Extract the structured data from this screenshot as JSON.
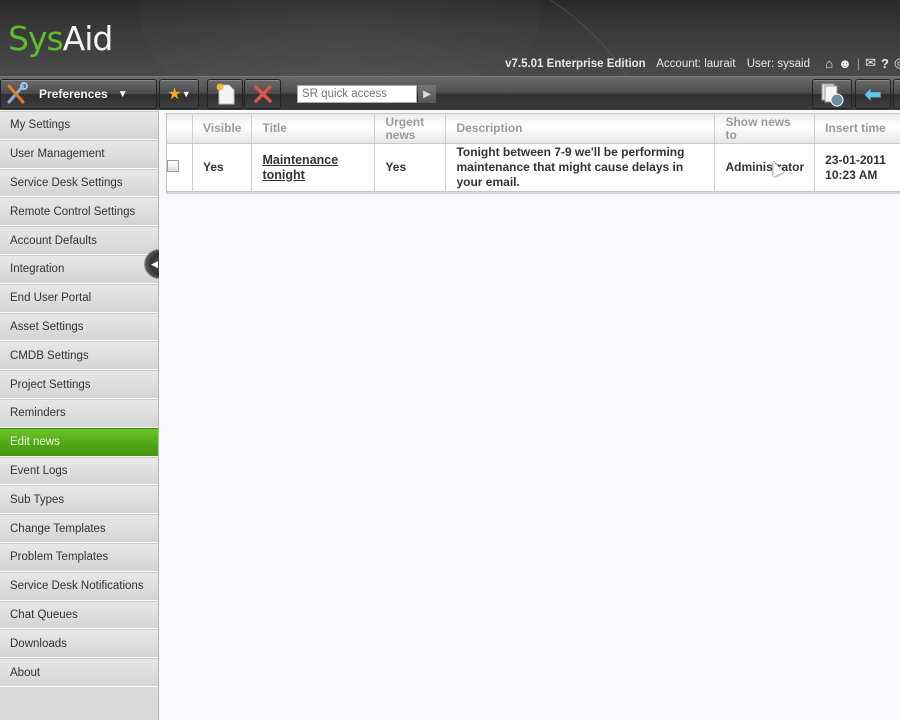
{
  "app": {
    "logo_left": "Sys",
    "logo_right": "Aid",
    "edition": "v7.5.01 Enterprise Edition",
    "account": "Account: laurait",
    "user": "User: sysaid",
    "accent_color": "#5cbf2a"
  },
  "header_icons": [
    {
      "name": "home-icon",
      "glyph": "⌂"
    },
    {
      "name": "user-icon",
      "glyph": "☻"
    },
    {
      "name": "separator",
      "glyph": "|"
    },
    {
      "name": "mail-icon",
      "glyph": "✉"
    },
    {
      "name": "help-icon",
      "glyph": "?"
    }
  ],
  "toolbar": {
    "preferences_label": "Preferences",
    "sr_placeholder": "SR quick access",
    "favorites_icon": "star-icon",
    "new_icon": "new-document-icon",
    "delete_icon": "delete-icon",
    "go_icon": "play-arrow-icon",
    "right_icons": [
      "report-icon",
      "back-arrow-icon"
    ]
  },
  "sidebar": {
    "items": [
      {
        "label": "My Settings",
        "active": false
      },
      {
        "label": "User Management",
        "active": false
      },
      {
        "label": "Service Desk Settings",
        "active": false
      },
      {
        "label": "Remote Control Settings",
        "active": false
      },
      {
        "label": "Account Defaults",
        "active": false
      },
      {
        "label": "Integration",
        "active": false
      },
      {
        "label": "End User Portal",
        "active": false
      },
      {
        "label": "Asset Settings",
        "active": false
      },
      {
        "label": "CMDB Settings",
        "active": false
      },
      {
        "label": "Project Settings",
        "active": false
      },
      {
        "label": "Reminders",
        "active": false
      },
      {
        "label": "Edit news",
        "active": true
      },
      {
        "label": "Event Logs",
        "active": false
      },
      {
        "label": "Sub Types",
        "active": false
      },
      {
        "label": "Change Templates",
        "active": false
      },
      {
        "label": "Problem Templates",
        "active": false
      },
      {
        "label": "Service Desk Notifications",
        "active": false
      },
      {
        "label": "Chat Queues",
        "active": false
      },
      {
        "label": "Downloads",
        "active": false
      },
      {
        "label": "About",
        "active": false
      }
    ]
  },
  "table": {
    "columns": [
      "",
      "Visible",
      "Title",
      "Urgent news",
      "Description",
      "Show news to",
      "Insert time"
    ],
    "rows": [
      {
        "checked": false,
        "visible": "Yes",
        "title": "Maintenance tonight",
        "urgent": "Yes",
        "description": "Tonight between 7-9 we'll be performing maintenance that might cause delays in your email.",
        "show_to": "Administrator",
        "insert_date": "23-01-2011",
        "insert_time": "10:23 AM"
      }
    ]
  }
}
